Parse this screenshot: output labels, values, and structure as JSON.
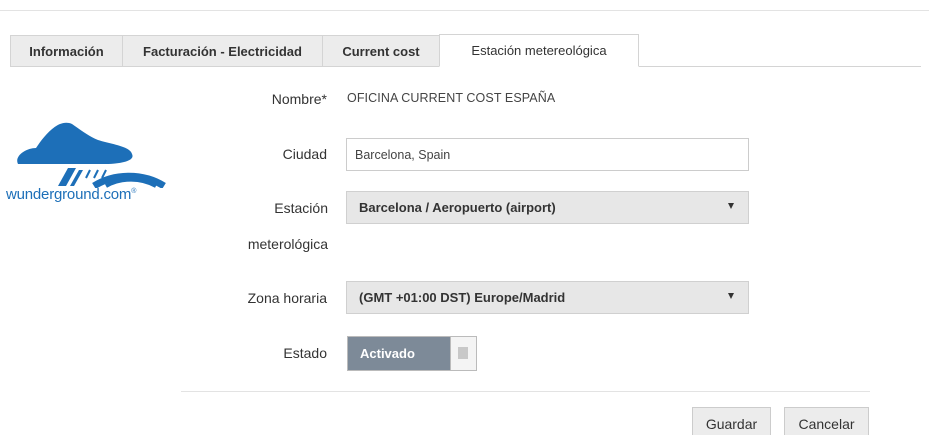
{
  "tabs": [
    {
      "label": "Información",
      "active": false
    },
    {
      "label": "Facturación - Electricidad",
      "active": false
    },
    {
      "label": "Current cost",
      "active": false
    },
    {
      "label": "Estación metereológica",
      "active": true
    }
  ],
  "logo": {
    "text": "wunderground.com",
    "trademark": "®",
    "brand_color": "#1d6fb8"
  },
  "form": {
    "name_label": "Nombre*",
    "name_value": "OFICINA CURRENT COST ESPAÑA",
    "city_label": "Ciudad",
    "city_value": "Barcelona, Spain",
    "station_label": "Estación meterológica",
    "station_value": "Barcelona / Aeropuerto (airport)",
    "timezone_label": "Zona horaria",
    "timezone_value": "(GMT +01:00 DST) Europe/Madrid",
    "state_label": "Estado",
    "state_value": "Activado",
    "state_on": true
  },
  "actions": {
    "save_label": "Guardar",
    "cancel_label": "Cancelar"
  },
  "colors": {
    "toggle_bg": "#7d8a98",
    "tab_bg": "#ececec",
    "select_bg": "#e7e7e7"
  }
}
